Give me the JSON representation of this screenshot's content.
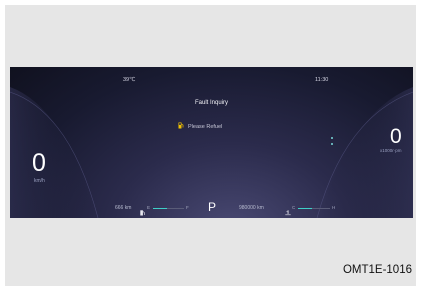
{
  "header": {
    "temperature": "39℃",
    "time": "11:30"
  },
  "alert": {
    "title": "Fault Inquiry",
    "message": "Please Refuel",
    "icon": "fuel-pump-icon",
    "icon_color": "#f2c200"
  },
  "speed": {
    "value": "0",
    "unit": "km/h"
  },
  "tachometer": {
    "value": "0",
    "unit": "x1000r·pm"
  },
  "bottom_bar": {
    "range_value": "666",
    "range_unit": "km",
    "fuel_gauge": {
      "icon": "fuel-pump-icon",
      "left_label": "E",
      "right_label": "F",
      "level": 0.45
    },
    "gear": "P",
    "odometer_value": "980000",
    "odometer_unit": "km",
    "temp_gauge": {
      "icon": "coolant-temperature-icon",
      "left_label": "C",
      "right_label": "H",
      "level": 0.45
    }
  },
  "accent_color": "#3fcfc7",
  "caption": "OMT1E-1016"
}
